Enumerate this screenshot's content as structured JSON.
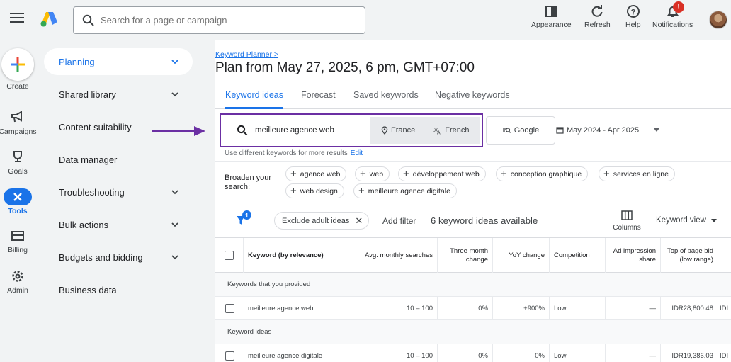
{
  "header": {
    "search_placeholder": "Search for a page or campaign",
    "actions": [
      {
        "label": "Appearance",
        "icon": "appearance-icon"
      },
      {
        "label": "Refresh",
        "icon": "refresh-icon"
      },
      {
        "label": "Help",
        "icon": "help-icon"
      },
      {
        "label": "Notifications",
        "icon": "bell-icon"
      }
    ],
    "notification_badge": "!"
  },
  "rail": {
    "create": "Create",
    "campaigns": "Campaigns",
    "goals": "Goals",
    "tools": "Tools",
    "billing": "Billing",
    "admin": "Admin"
  },
  "nav": {
    "items": [
      {
        "label": "Planning",
        "expandable": true,
        "active": true
      },
      {
        "label": "Shared library",
        "expandable": true
      },
      {
        "label": "Content suitability",
        "expandable": false
      },
      {
        "label": "Data manager",
        "expandable": false
      },
      {
        "label": "Troubleshooting",
        "expandable": true
      },
      {
        "label": "Bulk actions",
        "expandable": true
      },
      {
        "label": "Budgets and bidding",
        "expandable": true
      },
      {
        "label": "Business data",
        "expandable": false
      }
    ]
  },
  "main": {
    "breadcrumb": "Keyword Planner",
    "breadcrumb_sep": ">",
    "title": "Plan from May 27, 2025, 6 pm, GMT+07:00",
    "tabs": [
      {
        "label": "Keyword ideas",
        "active": true
      },
      {
        "label": "Forecast"
      },
      {
        "label": "Saved keywords"
      },
      {
        "label": "Negative keywords"
      }
    ],
    "keyword_query": "meilleure agence web",
    "location": "France",
    "language": "French",
    "network": "Google",
    "date_range": "May 2024 - Apr 2025",
    "hint": "Use different keywords for more results",
    "hint_link": "Edit",
    "broaden_label": "Broaden your search:",
    "broaden_chips": [
      "agence web",
      "web",
      "développement web",
      "conception graphique",
      "services en ligne",
      "web design",
      "meilleure agence digitale"
    ],
    "filter_count": "1",
    "exclude_chip": "Exclude adult ideas",
    "add_filter": "Add filter",
    "ideas_available": "6 keyword ideas available",
    "columns_label": "Columns",
    "keyword_view": "Keyword view"
  },
  "table": {
    "headers": [
      "Keyword (by relevance)",
      "Avg. monthly searches",
      "Three month change",
      "YoY change",
      "Competition",
      "Ad impression share",
      "Top of page bid (low range)"
    ],
    "group_provided": "Keywords that you provided",
    "group_ideas": "Keyword ideas",
    "rows": [
      {
        "keyword": "meilleure agence web",
        "searches": "10 – 100",
        "three_month": "0%",
        "yoy": "+900%",
        "competition": "Low",
        "impression": "—",
        "bid_low": "IDR28,800.48",
        "bid_high_cut": "IDI"
      },
      {
        "keyword": "meilleure agence digitale",
        "searches": "10 – 100",
        "three_month": "0%",
        "yoy": "0%",
        "competition": "Low",
        "impression": "—",
        "bid_low": "IDR19,386.03",
        "bid_high_cut": "IDI"
      }
    ]
  },
  "colors": {
    "accent": "#1a73e8",
    "highlight_box": "#6b2fa3",
    "arrow": "#6b2fa3",
    "notification": "#d93025"
  }
}
